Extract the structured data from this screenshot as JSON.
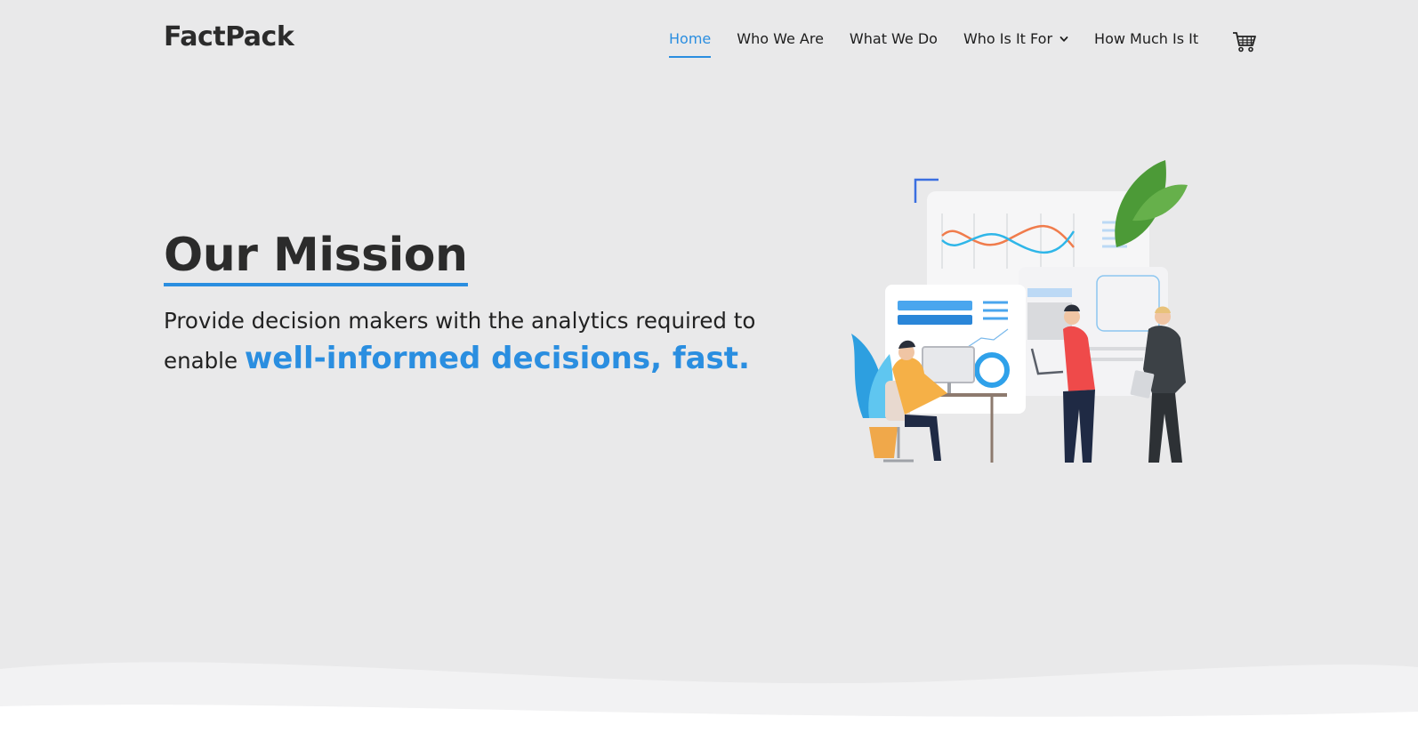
{
  "header": {
    "logo": "FactPack",
    "nav": [
      {
        "label": "Home",
        "active": true
      },
      {
        "label": "Who We Are"
      },
      {
        "label": "What We Do"
      },
      {
        "label": "Who Is It For",
        "has_dropdown": true
      },
      {
        "label": "How Much Is It"
      }
    ],
    "cart_icon": "shopping-cart-icon"
  },
  "hero": {
    "title": "Our Mission",
    "text_plain": "Provide decision makers with the analytics required to enable ",
    "text_highlight": "well-informed decisions, fast.",
    "illustration": "team-analytics-illustration"
  },
  "colors": {
    "accent": "#2a8ee0",
    "background": "#e9e9ea",
    "text": "#222222"
  }
}
